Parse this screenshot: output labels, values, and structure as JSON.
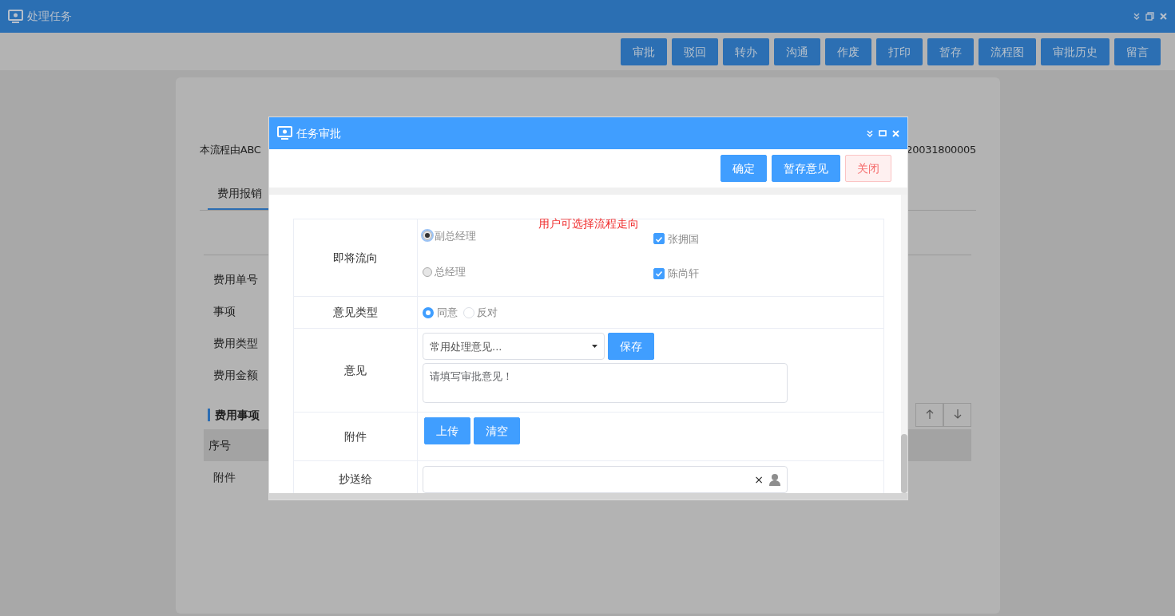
{
  "window": {
    "title": "处理任务"
  },
  "toolbar": {
    "buttons": [
      "审批",
      "驳回",
      "转办",
      "沟通",
      "作废",
      "打印",
      "暂存",
      "流程图",
      "审批历史",
      "留言"
    ]
  },
  "background_page": {
    "intro_start": "本流程由ABC",
    "intro_end": "20031800005",
    "tabs": [
      {
        "label": "费用报销",
        "selected": true
      }
    ],
    "fields": [
      "费用单号",
      "事项",
      "费用类型",
      "费用金额"
    ],
    "section_title": "费用事项",
    "table": {
      "columns": [
        "序号"
      ]
    },
    "attachment_label": "附件"
  },
  "dialog": {
    "title": "任务审批",
    "buttons": [
      {
        "label": "确定",
        "kind": "primary"
      },
      {
        "label": "暂存意见",
        "kind": "primary"
      },
      {
        "label": "关闭",
        "kind": "danger"
      }
    ],
    "hint": "用户可选择流程走向",
    "rows": [
      {
        "kind": "route",
        "label": "即将流向",
        "options": [
          {
            "label": "副总经理",
            "selected": true,
            "assignee": {
              "label": "张拥国",
              "checked": true
            }
          },
          {
            "label": "总经理",
            "selected": false,
            "assignee": {
              "label": "陈尚轩",
              "checked": true
            }
          }
        ]
      },
      {
        "kind": "radio",
        "label": "意见类型",
        "options": [
          {
            "label": "同意",
            "selected": true
          },
          {
            "label": "反对",
            "selected": false
          }
        ]
      },
      {
        "kind": "opinion",
        "label": "意见",
        "select": {
          "value": "常用处理意见..."
        },
        "save_button": "保存",
        "textarea": {
          "placeholder": "请填写审批意见！"
        }
      },
      {
        "kind": "buttons",
        "label": "附件",
        "buttons": [
          "上传",
          "清空"
        ]
      },
      {
        "kind": "picker",
        "label": "抄送给",
        "clear": "×"
      }
    ]
  }
}
